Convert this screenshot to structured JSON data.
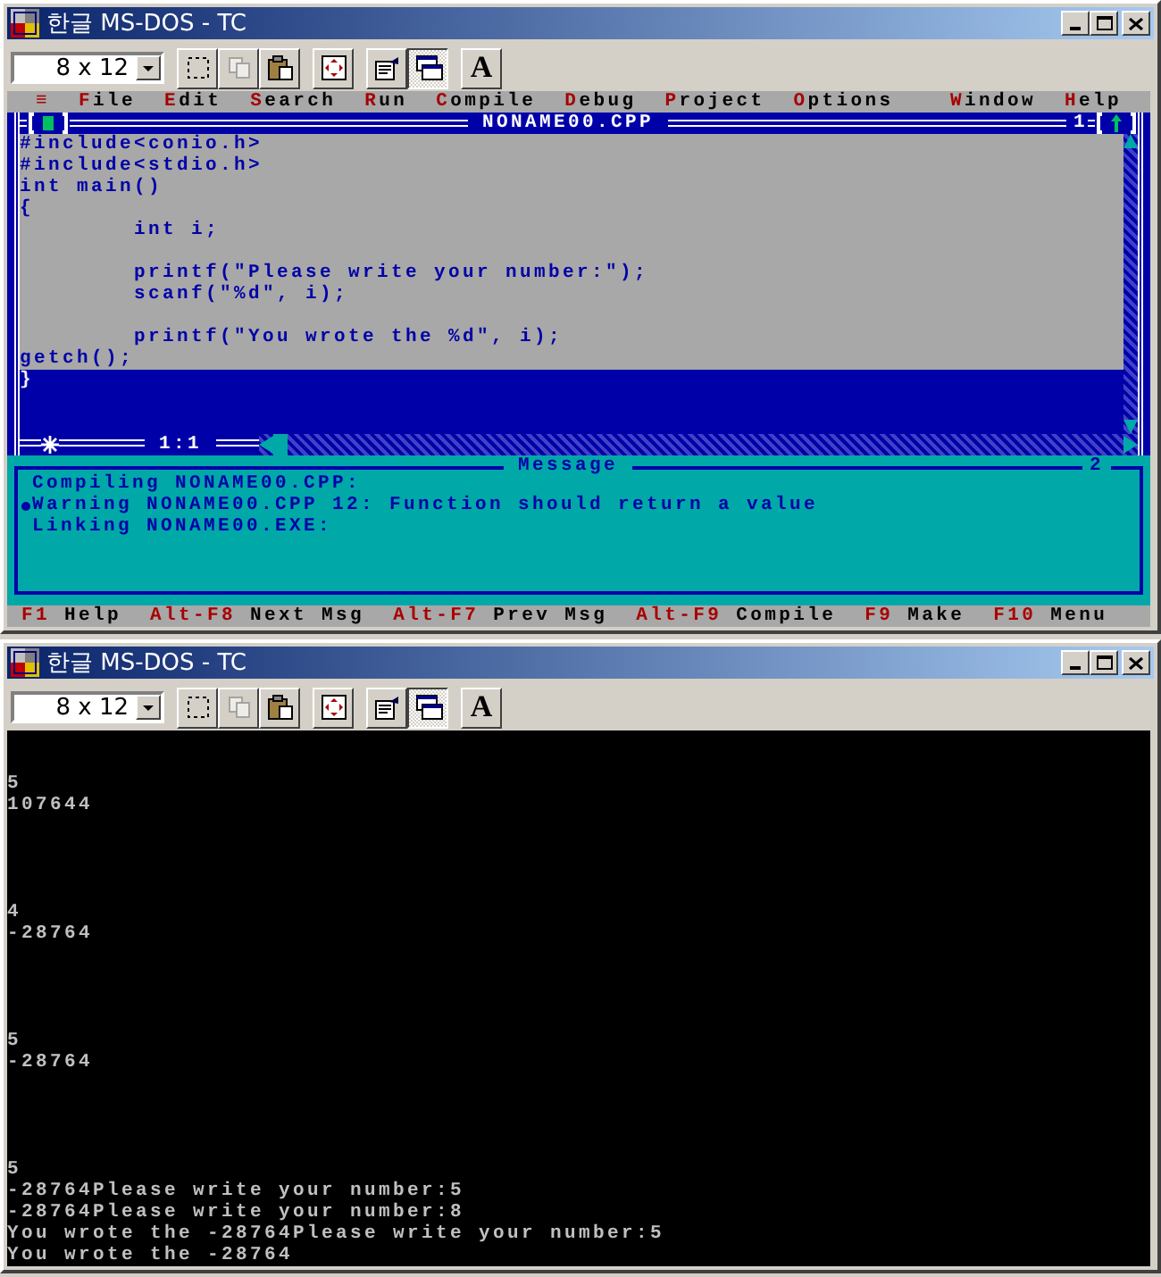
{
  "ide_window": {
    "title": "한글 MS-DOS - TC",
    "toolbar": {
      "font_size": "8 x 12",
      "buttons": [
        {
          "kind": "mark",
          "selected": false,
          "disabled": false
        },
        {
          "kind": "copy",
          "selected": false,
          "disabled": true
        },
        {
          "kind": "paste",
          "selected": false,
          "disabled": false
        },
        {
          "kind": "fullscreen",
          "selected": false,
          "disabled": false
        },
        {
          "kind": "properties",
          "selected": false,
          "disabled": false
        },
        {
          "kind": "background",
          "selected": true,
          "disabled": false
        },
        {
          "kind": "font",
          "label": "A",
          "selected": false,
          "disabled": false
        }
      ]
    },
    "menu": [
      {
        "label": "≡",
        "at_right": false
      },
      {
        "label": "File",
        "at_right": false
      },
      {
        "label": "Edit",
        "at_right": false
      },
      {
        "label": "Search",
        "at_right": false
      },
      {
        "label": "Run",
        "at_right": false
      },
      {
        "label": "Compile",
        "at_right": false
      },
      {
        "label": "Debug",
        "at_right": false
      },
      {
        "label": "Project",
        "at_right": false
      },
      {
        "label": "Options",
        "at_right": false
      },
      {
        "label": "Window",
        "at_right": true
      },
      {
        "label": "Help",
        "at_right": true
      }
    ],
    "editor": {
      "title": "NONAME00.CPP",
      "number": "1",
      "position": "1:1",
      "lines": [
        {
          "text": "#include<conio.h>",
          "indented": false,
          "gap_before": false,
          "selected": true
        },
        {
          "text": "#include<stdio.h>",
          "indented": false,
          "gap_before": false,
          "selected": true
        },
        {
          "text": "int main()",
          "indented": false,
          "gap_before": false,
          "selected": true
        },
        {
          "text": "{",
          "indented": false,
          "gap_before": false,
          "selected": true
        },
        {
          "text": "int i;",
          "indented": true,
          "gap_before": false,
          "selected": true
        },
        {
          "text": "printf(\"Please write your number:\");",
          "indented": true,
          "gap_before": true,
          "selected": true
        },
        {
          "text": "scanf(\"%d\", i);",
          "indented": true,
          "gap_before": false,
          "selected": true
        },
        {
          "text": "printf(\"You wrote the %d\", i);",
          "indented": true,
          "gap_before": true,
          "selected": true
        },
        {
          "text": "getch();",
          "indented": false,
          "gap_before": false,
          "selected": true
        },
        {
          "text": "}",
          "indented": false,
          "gap_before": false,
          "selected": false
        }
      ]
    },
    "messages": {
      "title": "Message",
      "number": "2",
      "lines": [
        {
          "text": "Compiling NONAME00.CPP:",
          "selected": false
        },
        {
          "text": "Warning NONAME00.CPP 12: Function should return a value",
          "selected": true
        },
        {
          "text": "Linking NONAME00.EXE:",
          "selected": false
        }
      ]
    },
    "status_bar": [
      {
        "key": "F1",
        "action": "Help"
      },
      {
        "key": "Alt-F8",
        "action": "Next Msg"
      },
      {
        "key": "Alt-F7",
        "action": "Prev Msg"
      },
      {
        "key": "Alt-F9",
        "action": "Compile"
      },
      {
        "key": "F9",
        "action": "Make"
      },
      {
        "key": "F10",
        "action": "Menu"
      }
    ]
  },
  "console_window": {
    "title": "한글 MS-DOS - TC",
    "toolbar": {
      "font_size": "8 x 12",
      "buttons": [
        {
          "kind": "mark",
          "selected": false,
          "disabled": false
        },
        {
          "kind": "copy",
          "selected": false,
          "disabled": true
        },
        {
          "kind": "paste",
          "selected": false,
          "disabled": false
        },
        {
          "kind": "fullscreen",
          "selected": false,
          "disabled": false
        },
        {
          "kind": "properties",
          "selected": false,
          "disabled": false
        },
        {
          "kind": "background",
          "selected": true,
          "disabled": false
        },
        {
          "kind": "font",
          "label": "A",
          "selected": false,
          "disabled": false
        }
      ]
    },
    "output_blocks": [
      [
        "5",
        "107644"
      ],
      [
        "4",
        "-28764"
      ],
      [
        "5",
        "-28764"
      ],
      [
        "5",
        "-28764Please write your number:5",
        "-28764Please write your number:8",
        "You wrote the -28764Please write your number:5",
        "You wrote the -28764"
      ]
    ]
  }
}
